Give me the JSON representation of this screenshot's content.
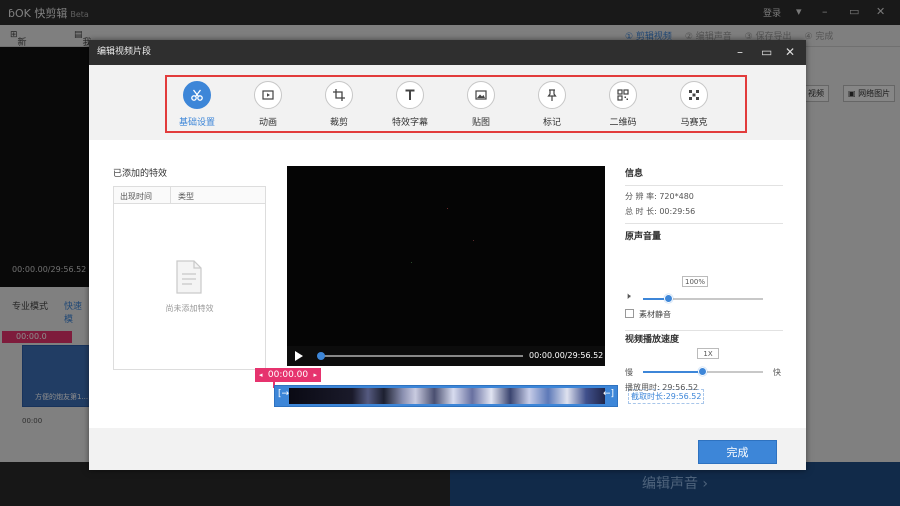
{
  "app": {
    "logo": "ɓOK 快剪辑",
    "beta": "Beta",
    "login": "登录",
    "new_project": "新建项目",
    "my_project": "我的项目",
    "steps": [
      "① 剪辑视频",
      "② 编辑声音",
      "③ 保存导出",
      "④ 完成"
    ],
    "preview_time": "00:00.00/29:56.52",
    "mode_pro": "专业模式",
    "mode_fast": "快速模",
    "timeline_marker": "00:00.0",
    "clip_label": "方便的炮友第1...",
    "timeline_time": "00:00",
    "btn_video": "视频",
    "btn_netimg": "网络图片",
    "bottom_sound": "编辑声音 ›"
  },
  "dialog": {
    "title": "编辑视频片段",
    "tabs": [
      {
        "label": "基础设置",
        "icon": "scissors-icon"
      },
      {
        "label": "动画",
        "icon": "play-screen-icon"
      },
      {
        "label": "裁剪",
        "icon": "crop-icon"
      },
      {
        "label": "特效字幕",
        "icon": "text-t-icon"
      },
      {
        "label": "贴图",
        "icon": "image-icon"
      },
      {
        "label": "标记",
        "icon": "pin-icon"
      },
      {
        "label": "二维码",
        "icon": "qrcode-icon"
      },
      {
        "label": "马赛克",
        "icon": "mosaic-icon"
      }
    ],
    "effects_title": "已添加的特效",
    "col_time": "出现时间",
    "col_type": "类型",
    "empty_text": "尚未添加特效",
    "video_time": "00:00.00/29:56.52",
    "strip_marker": "00:00.00",
    "clip_length": "截取时长:29:56.52",
    "info_title": "信息",
    "resolution_label": "分 辨 率:",
    "resolution_value": "720*480",
    "duration_label": "总 时 长:",
    "duration_value": "00:29:56",
    "volume_title": "原声音量",
    "volume_value": "100%",
    "volume_level": 0.22,
    "mute_label": "素材静音",
    "speed_title": "视频播放速度",
    "speed_value": "1X",
    "speed_slow": "慢",
    "speed_fast": "快",
    "speed_level": 0.5,
    "play_time_label": "播放用时:",
    "play_time_value": "29:56.52",
    "done_label": "完成",
    "accent_color": "#3d86d8",
    "marker_color": "#e6336e"
  }
}
